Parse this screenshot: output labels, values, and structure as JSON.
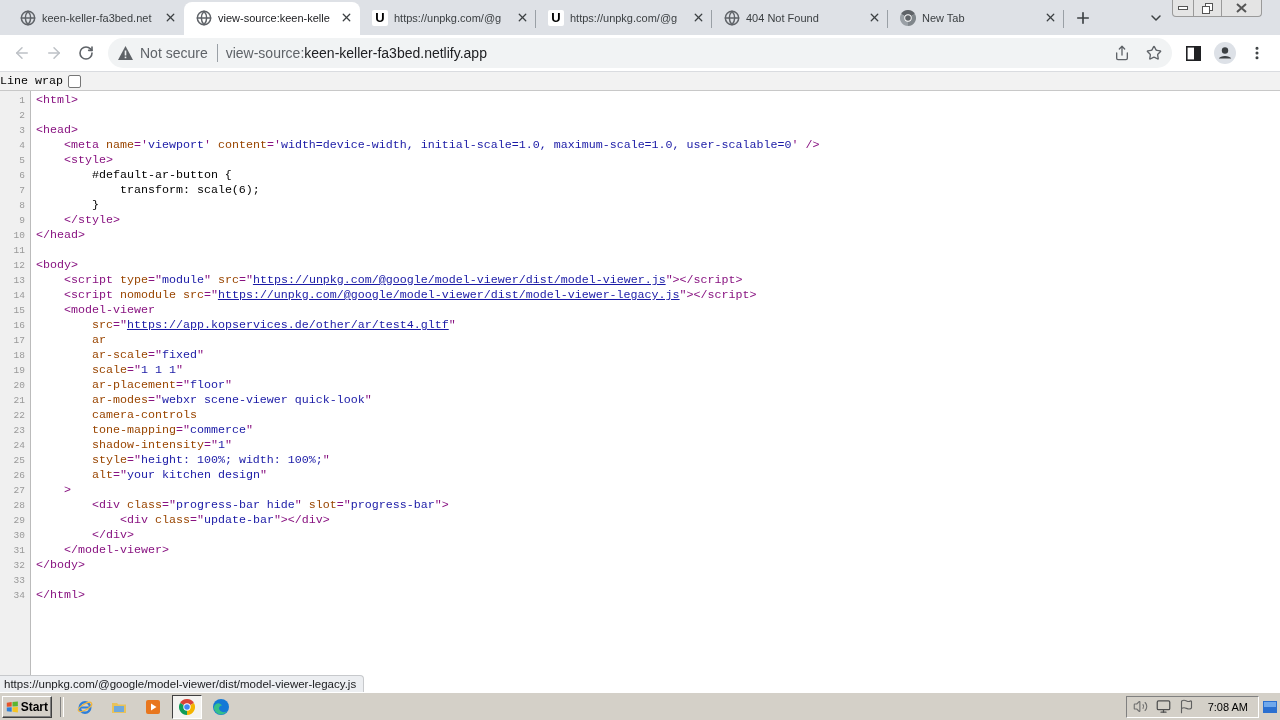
{
  "browser": {
    "tabs": [
      {
        "title": "keen-keller-fa3bed.net",
        "selected": false,
        "favicon": {
          "kind": "globe"
        }
      },
      {
        "title": "view-source:keen-kelle",
        "selected": true,
        "favicon": {
          "kind": "globe"
        }
      },
      {
        "title": "https://unpkg.com/@g",
        "selected": false,
        "favicon": {
          "kind": "letter",
          "text": "U"
        }
      },
      {
        "title": "https://unpkg.com/@g",
        "selected": false,
        "favicon": {
          "kind": "letter",
          "text": "U"
        }
      },
      {
        "title": "404 Not Found",
        "selected": false,
        "favicon": {
          "kind": "globe"
        }
      },
      {
        "title": "New Tab",
        "selected": false,
        "favicon": {
          "kind": "wheel"
        }
      }
    ],
    "toolbar": {
      "nav_buttons": [
        {
          "kind": "back",
          "disabled": true
        },
        {
          "kind": "forward",
          "disabled": true
        },
        {
          "kind": "reload",
          "disabled": false
        }
      ],
      "address_bar": {
        "security_label": "Not secure",
        "scheme": "view-source:",
        "host": "keen-keller-fa3bed.netlify.app"
      }
    }
  },
  "page": {
    "line_wrap": {
      "label": "Line wrap",
      "checked": false
    },
    "lines": [
      {
        "number": "1",
        "tokens": [
          {
            "kind": "tag",
            "text": "<html>"
          }
        ]
      },
      {
        "number": "2"
      },
      {
        "number": "3",
        "tokens": [
          {
            "kind": "tag",
            "text": "<head>"
          }
        ]
      },
      {
        "number": "4",
        "tokens": [
          {
            "kind": "tag",
            "text": "    <meta "
          },
          {
            "kind": "attr",
            "text": "name"
          },
          {
            "kind": "tag",
            "text": "='"
          },
          {
            "kind": "value",
            "text": "viewport"
          },
          {
            "kind": "tag",
            "text": "' "
          },
          {
            "kind": "attr",
            "text": "content"
          },
          {
            "kind": "tag",
            "text": "='"
          },
          {
            "kind": "value",
            "text": "width=device-width, initial-scale=1.0, maximum-scale=1.0, user-scalable=0"
          },
          {
            "kind": "tag",
            "text": "' />"
          }
        ]
      },
      {
        "number": "5",
        "tokens": [
          {
            "kind": "tag",
            "text": "    <style>"
          }
        ]
      },
      {
        "number": "6",
        "tokens": [
          {
            "kind": "text",
            "text": "        #default-ar-button {"
          }
        ]
      },
      {
        "number": "7",
        "tokens": [
          {
            "kind": "text",
            "text": "            transform: scale(6);"
          }
        ]
      },
      {
        "number": "8",
        "tokens": [
          {
            "kind": "text",
            "text": "        }"
          }
        ]
      },
      {
        "number": "9",
        "tokens": [
          {
            "kind": "tag",
            "text": "    </style>"
          }
        ]
      },
      {
        "number": "10",
        "tokens": [
          {
            "kind": "tag",
            "text": "</head>"
          }
        ]
      },
      {
        "number": "11"
      },
      {
        "number": "12",
        "tokens": [
          {
            "kind": "tag",
            "text": "<body>"
          }
        ]
      },
      {
        "number": "13",
        "tokens": [
          {
            "kind": "tag",
            "text": "    <script "
          },
          {
            "kind": "attr",
            "text": "type"
          },
          {
            "kind": "tag",
            "text": "=\""
          },
          {
            "kind": "value",
            "text": "module"
          },
          {
            "kind": "tag",
            "text": "\" "
          },
          {
            "kind": "attr",
            "text": "src"
          },
          {
            "kind": "tag",
            "text": "=\""
          },
          {
            "kind": "link",
            "text": "https://unpkg.com/@google/model-viewer/dist/model-viewer.js"
          },
          {
            "kind": "tag",
            "text": "\"></script>"
          }
        ]
      },
      {
        "number": "14",
        "tokens": [
          {
            "kind": "tag",
            "text": "    <script "
          },
          {
            "kind": "attr",
            "text": "nomodule src"
          },
          {
            "kind": "tag",
            "text": "=\""
          },
          {
            "kind": "link",
            "text": "https://unpkg.com/@google/model-viewer/dist/model-viewer-legacy.js"
          },
          {
            "kind": "tag",
            "text": "\"></script>"
          }
        ]
      },
      {
        "number": "15",
        "tokens": [
          {
            "kind": "tag",
            "text": "    <model-viewer"
          }
        ]
      },
      {
        "number": "16",
        "tokens": [
          {
            "kind": "attr",
            "text": "        src"
          },
          {
            "kind": "tag",
            "text": "=\""
          },
          {
            "kind": "link",
            "text": "https://app.kopservices.de/other/ar/test4.gltf"
          },
          {
            "kind": "tag",
            "text": "\""
          }
        ]
      },
      {
        "number": "17",
        "tokens": [
          {
            "kind": "attr",
            "text": "        ar"
          }
        ]
      },
      {
        "number": "18",
        "tokens": [
          {
            "kind": "attr",
            "text": "        ar-scale"
          },
          {
            "kind": "tag",
            "text": "=\""
          },
          {
            "kind": "value",
            "text": "fixed"
          },
          {
            "kind": "tag",
            "text": "\""
          }
        ]
      },
      {
        "number": "19",
        "tokens": [
          {
            "kind": "attr",
            "text": "        scale"
          },
          {
            "kind": "tag",
            "text": "=\""
          },
          {
            "kind": "value",
            "text": "1 1 1"
          },
          {
            "kind": "tag",
            "text": "\""
          }
        ]
      },
      {
        "number": "20",
        "tokens": [
          {
            "kind": "attr",
            "text": "        ar-placement"
          },
          {
            "kind": "tag",
            "text": "=\""
          },
          {
            "kind": "value",
            "text": "floor"
          },
          {
            "kind": "tag",
            "text": "\""
          }
        ]
      },
      {
        "number": "21",
        "tokens": [
          {
            "kind": "attr",
            "text": "        ar-modes"
          },
          {
            "kind": "tag",
            "text": "=\""
          },
          {
            "kind": "value",
            "text": "webxr scene-viewer quick-look"
          },
          {
            "kind": "tag",
            "text": "\""
          }
        ]
      },
      {
        "number": "22",
        "tokens": [
          {
            "kind": "attr",
            "text": "        camera-controls"
          }
        ]
      },
      {
        "number": "23",
        "tokens": [
          {
            "kind": "attr",
            "text": "        tone-mapping"
          },
          {
            "kind": "tag",
            "text": "=\""
          },
          {
            "kind": "value",
            "text": "commerce"
          },
          {
            "kind": "tag",
            "text": "\""
          }
        ]
      },
      {
        "number": "24",
        "tokens": [
          {
            "kind": "attr",
            "text": "        shadow-intensity"
          },
          {
            "kind": "tag",
            "text": "=\""
          },
          {
            "kind": "value",
            "text": "1"
          },
          {
            "kind": "tag",
            "text": "\""
          }
        ]
      },
      {
        "number": "25",
        "tokens": [
          {
            "kind": "attr",
            "text": "        style"
          },
          {
            "kind": "tag",
            "text": "=\""
          },
          {
            "kind": "value",
            "text": "height: 100%; width: 100%;"
          },
          {
            "kind": "tag",
            "text": "\""
          }
        ]
      },
      {
        "number": "26",
        "tokens": [
          {
            "kind": "attr",
            "text": "        alt"
          },
          {
            "kind": "tag",
            "text": "=\""
          },
          {
            "kind": "value",
            "text": "your kitchen design"
          },
          {
            "kind": "tag",
            "text": "\""
          }
        ]
      },
      {
        "number": "27",
        "tokens": [
          {
            "kind": "tag",
            "text": "    >"
          }
        ]
      },
      {
        "number": "28",
        "tokens": [
          {
            "kind": "tag",
            "text": "        <div "
          },
          {
            "kind": "attr",
            "text": "class"
          },
          {
            "kind": "tag",
            "text": "=\""
          },
          {
            "kind": "value",
            "text": "progress-bar hide"
          },
          {
            "kind": "tag",
            "text": "\" "
          },
          {
            "kind": "attr",
            "text": "slot"
          },
          {
            "kind": "tag",
            "text": "=\""
          },
          {
            "kind": "value",
            "text": "progress-bar"
          },
          {
            "kind": "tag",
            "text": "\">"
          }
        ]
      },
      {
        "number": "29",
        "tokens": [
          {
            "kind": "tag",
            "text": "            <div "
          },
          {
            "kind": "attr",
            "text": "class"
          },
          {
            "kind": "tag",
            "text": "=\""
          },
          {
            "kind": "value",
            "text": "update-bar"
          },
          {
            "kind": "tag",
            "text": "\"></div>"
          }
        ]
      },
      {
        "number": "30",
        "tokens": [
          {
            "kind": "tag",
            "text": "        </div>"
          }
        ]
      },
      {
        "number": "31",
        "tokens": [
          {
            "kind": "tag",
            "text": "    </model-viewer>"
          }
        ]
      },
      {
        "number": "32",
        "tokens": [
          {
            "kind": "tag",
            "text": "</body>"
          }
        ]
      },
      {
        "number": "33"
      },
      {
        "number": "34",
        "tokens": [
          {
            "kind": "tag",
            "text": "</html>"
          }
        ]
      }
    ]
  },
  "status_bubble": "https://unpkg.com/@google/model-viewer/dist/model-viewer-legacy.js",
  "taskbar": {
    "start_label": "Start",
    "quick_launch": [
      {
        "kind": "browser",
        "selected": false
      },
      {
        "kind": "folder",
        "selected": false
      },
      {
        "kind": "player",
        "selected": false
      },
      {
        "kind": "wheel",
        "selected": true
      },
      {
        "kind": "swirl",
        "selected": false
      }
    ],
    "clock": "7:08 AM"
  }
}
